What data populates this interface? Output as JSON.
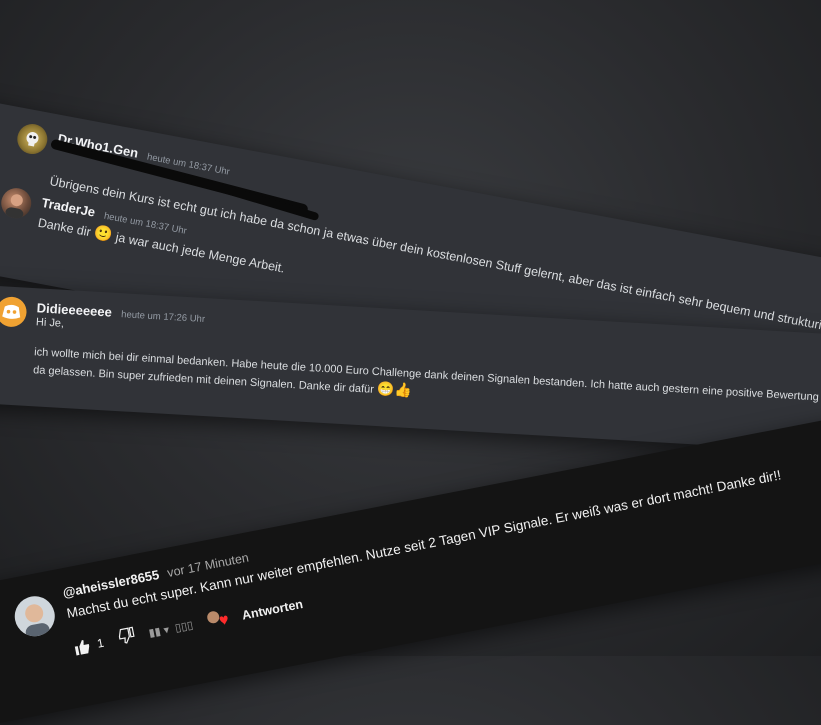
{
  "discord_card_1": {
    "msg1": {
      "username": "Dr.Who1.Gen",
      "timestamp": "heute um 18:37 Uhr",
      "text": "Übrigens  dein Kurs ist echt gut ich habe da schon ja etwas über dein kostenlosen Stuff gelernt, aber das ist einfach sehr bequem und strukturiert:)"
    },
    "msg2": {
      "username": "TraderJe",
      "timestamp": "heute um 18:37 Uhr",
      "text_before_emoji": "Danke dir",
      "emoji": "🙂",
      "text_after_emoji": "ja war auch jede Menge Arbeit."
    }
  },
  "discord_card_2": {
    "username": "Didieeeeeee",
    "timestamp": "heute um 17:26 Uhr",
    "greeting": "Hi Je,",
    "line1": "ich wollte mich bei dir einmal bedanken. Habe heute die 10.000 Euro Challenge dank deinen Signalen bestanden. Ich hatte auch gestern eine positive Bewertung",
    "line2": "da gelassen. Bin super zufrieden mit deinen Signalen. Danke dir dafür",
    "emojis": "😁👍"
  },
  "youtube_comment": {
    "handle": "@aheissler8655",
    "time": "vor 17 Minuten",
    "text": "Machst du echt super. Kann nur weiter empfehlen. Nutze seit 2 Tagen VIP Signale. Er weiß was er dort macht! Danke dir!!",
    "like_count": "1",
    "reply_label": "Antworten"
  }
}
